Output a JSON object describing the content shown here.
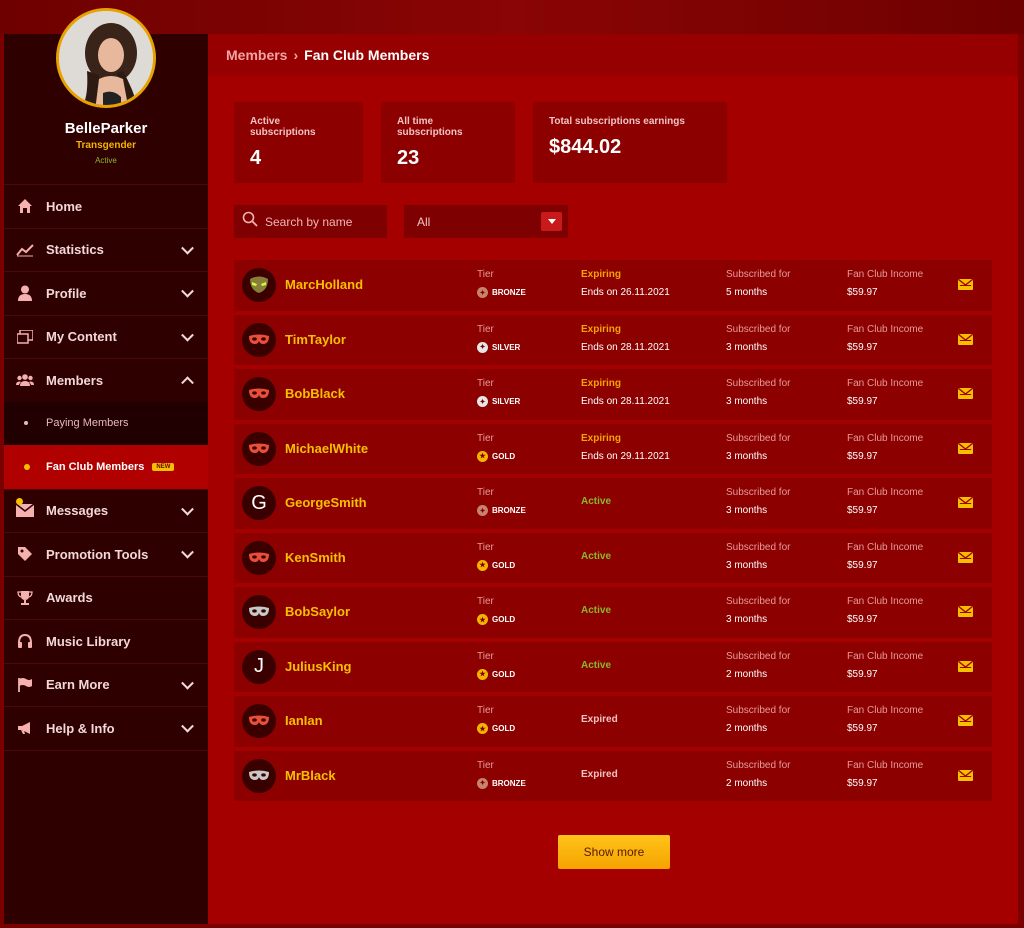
{
  "profile": {
    "name": "BelleParker",
    "gender": "Transgender",
    "status": "Active"
  },
  "nav": {
    "home": "Home",
    "statistics": "Statistics",
    "profile": "Profile",
    "my_content": "My Content",
    "members": "Members",
    "paying_members": "Paying Members",
    "fan_club_members": "Fan Club Members",
    "new_badge": "NEW",
    "messages": "Messages",
    "promotion_tools": "Promotion Tools",
    "awards": "Awards",
    "music_library": "Music Library",
    "earn_more": "Earn More",
    "help_info": "Help & Info"
  },
  "breadcrumb": {
    "parent": "Members",
    "separator": "›",
    "current": "Fan Club Members"
  },
  "stats": {
    "active_label": "Active subscriptions",
    "active_value": "4",
    "alltime_label": "All time subscriptions",
    "alltime_value": "23",
    "earnings_label": "Total subscriptions earnings",
    "earnings_value": "$844.02"
  },
  "search": {
    "placeholder": "Search by name"
  },
  "filter": {
    "selected": "All"
  },
  "labels": {
    "tier": "Tier",
    "subscribed_for": "Subscribed for",
    "fan_club_income": "Fan Club Income"
  },
  "colors": {
    "accent": "#f5c000",
    "expiring": "#f5a300",
    "active": "#8db72a",
    "expired": "#f3c3c3"
  },
  "members": [
    {
      "name": "MarcHolland",
      "avatar": "alien-mask-icon",
      "tier": "BRONZE",
      "status": "Expiring",
      "ends": "Ends on 26.11.2021",
      "subscribed": "5 months",
      "income": "$59.97"
    },
    {
      "name": "TimTaylor",
      "avatar": "mask-icon",
      "tier": "SILVER",
      "status": "Expiring",
      "ends": "Ends on 28.11.2021",
      "subscribed": "3 months",
      "income": "$59.97"
    },
    {
      "name": "BobBlack",
      "avatar": "mask-icon",
      "tier": "SILVER",
      "status": "Expiring",
      "ends": "Ends on 28.11.2021",
      "subscribed": "3 months",
      "income": "$59.97"
    },
    {
      "name": "MichaelWhite",
      "avatar": "mask-icon",
      "tier": "GOLD",
      "status": "Expiring",
      "ends": "Ends on 29.11.2021",
      "subscribed": "3 months",
      "income": "$59.97"
    },
    {
      "name": "GeorgeSmith",
      "avatar": "G",
      "tier": "BRONZE",
      "status": "Active",
      "ends": "",
      "subscribed": "3 months",
      "income": "$59.97"
    },
    {
      "name": "KenSmith",
      "avatar": "mask-icon",
      "tier": "GOLD",
      "status": "Active",
      "ends": "",
      "subscribed": "3 months",
      "income": "$59.97"
    },
    {
      "name": "BobSaylor",
      "avatar": "grey-mask-icon",
      "tier": "GOLD",
      "status": "Active",
      "ends": "",
      "subscribed": "3 months",
      "income": "$59.97"
    },
    {
      "name": "JuliusKing",
      "avatar": "J",
      "tier": "GOLD",
      "status": "Active",
      "ends": "",
      "subscribed": "2 months",
      "income": "$59.97"
    },
    {
      "name": "IanIan",
      "avatar": "mask-icon",
      "tier": "GOLD",
      "status": "Expired",
      "ends": "",
      "subscribed": "2 months",
      "income": "$59.97"
    },
    {
      "name": "MrBlack",
      "avatar": "grey-mask-icon",
      "tier": "BRONZE",
      "status": "Expired",
      "ends": "",
      "subscribed": "2 months",
      "income": "$59.97"
    }
  ],
  "show_more": "Show more"
}
